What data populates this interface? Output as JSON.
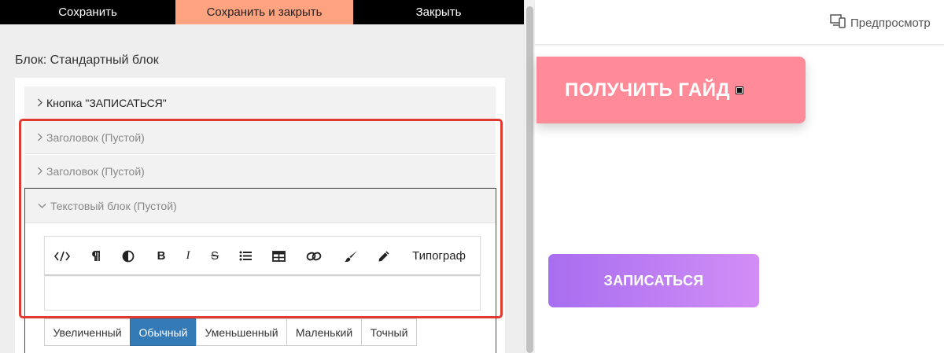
{
  "topbar": {
    "save_label": "Сохранить",
    "save_close_label": "Сохранить и закрыть",
    "close_label": "Закрыть"
  },
  "editor": {
    "block_title": "Блок: Стандартный блок",
    "accordion": [
      {
        "label": "Кнопка \"ЗАПИСАТЬСЯ\"",
        "expanded": false
      },
      {
        "label": "Заголовок (Пустой)",
        "expanded": false
      },
      {
        "label": "Заголовок (Пустой)",
        "expanded": false
      },
      {
        "label": "Текстовый блок (Пустой)",
        "expanded": true
      }
    ],
    "toolbar": {
      "tools": [
        "code-icon",
        "paragraph-icon",
        "contrast-icon",
        "bold-icon",
        "italic-icon",
        "strikethrough-icon",
        "list-icon",
        "table-icon",
        "link-icon",
        "brush-icon",
        "pen-icon"
      ],
      "bold_glyph": "B",
      "italic_glyph": "I",
      "strike_glyph": "S",
      "typograph_label": "Типограф"
    },
    "editor_text": "",
    "sizes": [
      {
        "label": "Увеличенный",
        "active": false
      },
      {
        "label": "Обычный",
        "active": true
      },
      {
        "label": "Уменьшенный",
        "active": false
      },
      {
        "label": "Маленький",
        "active": false
      },
      {
        "label": "Точный",
        "active": false
      }
    ],
    "highlight_color": "#e03a31"
  },
  "preview": {
    "preview_label": "Предпросмотр",
    "guide_button_label": "ПОЛУЧИТЬ ГАЙД",
    "signup_button_label": "ЗАПИСАТЬСЯ",
    "colors": {
      "save_close_bg": "#ffa27f",
      "guide_bg": "#ff8a98",
      "signup_gradient_start": "#a86ef0",
      "signup_gradient_end": "#d28ef5",
      "active_size_bg": "#337ab7"
    }
  }
}
